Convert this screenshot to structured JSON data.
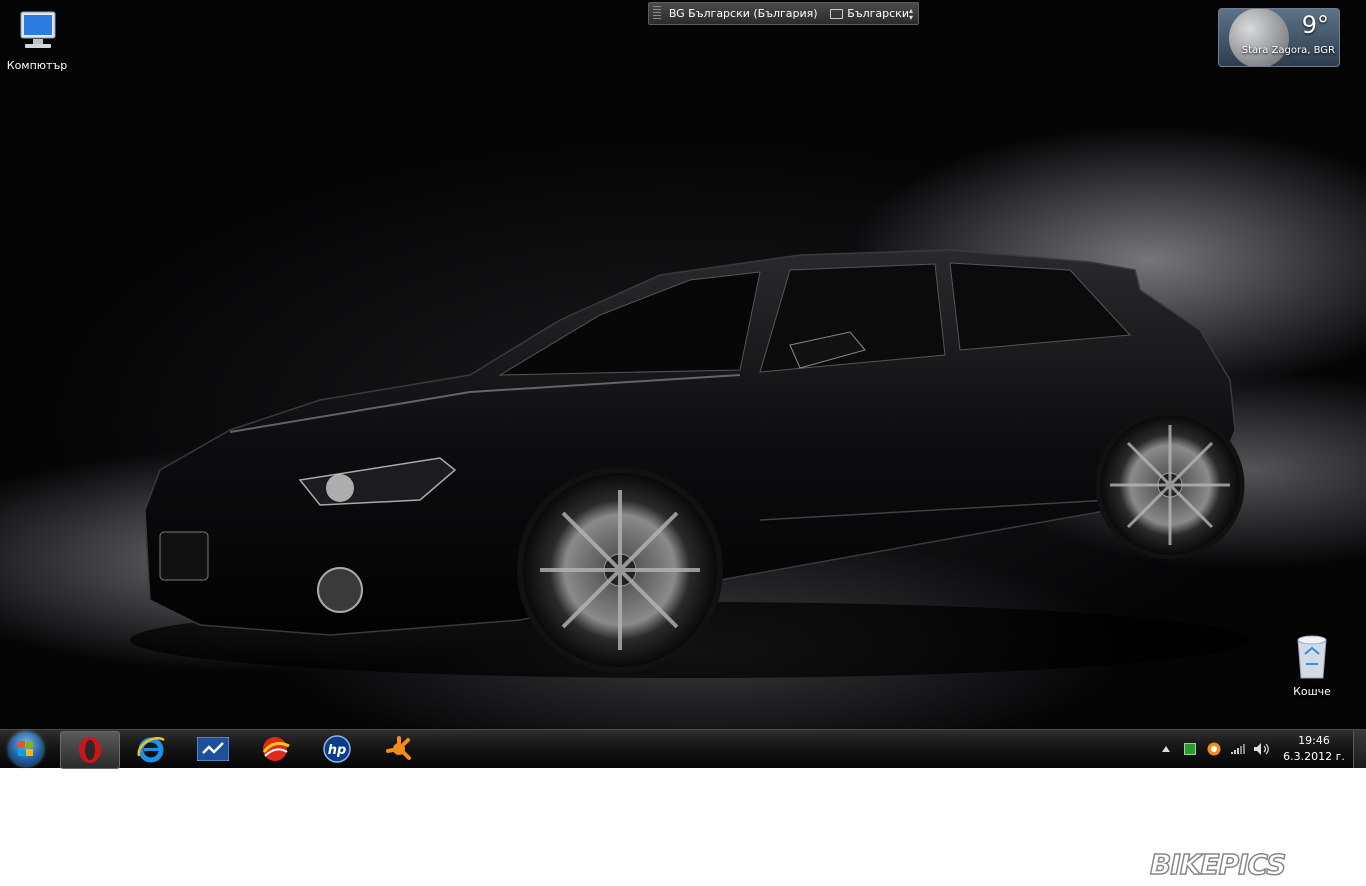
{
  "desktop": {
    "icons": [
      {
        "label": "Компютър",
        "icon": "computer-icon"
      },
      {
        "label": "Кошче",
        "icon": "recycle-bin-icon"
      }
    ]
  },
  "langbar": {
    "language": "BG Български (България)",
    "layout": "Български"
  },
  "weather": {
    "temperature": "9°",
    "location": "Stara Zagora, BGR"
  },
  "taskbar": {
    "pinned": [
      "start-orb",
      "opera-icon",
      "internet-explorer-icon",
      "app-icon",
      "media-center-icon",
      "hp-icon",
      "avast-icon"
    ]
  },
  "clock": {
    "time": "19:46",
    "date": "6.3.2012 г."
  },
  "watermark": "BIKEPICS",
  "colors": {
    "taskbar": "#151515",
    "opera_red": "#d0121a",
    "avast_orange": "#f28c1a",
    "ie_blue": "#1e90e6"
  }
}
